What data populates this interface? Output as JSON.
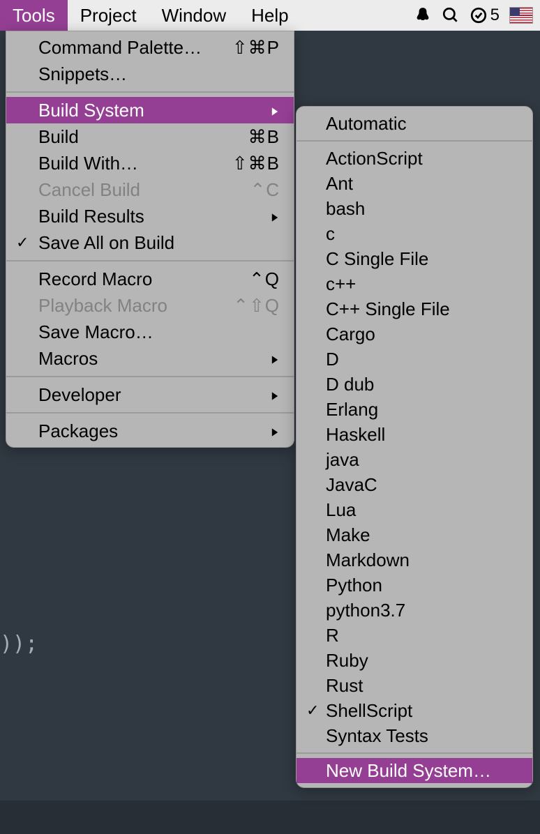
{
  "menubar": {
    "items": [
      {
        "label": "Tools",
        "active": true
      },
      {
        "label": "Project",
        "active": false
      },
      {
        "label": "Window",
        "active": false
      },
      {
        "label": "Help",
        "active": false
      }
    ],
    "badge_count": "5"
  },
  "editor": {
    "code_visible": "));"
  },
  "tools_menu": {
    "items": [
      {
        "label": "Command Palette…",
        "shortcut": "⇧⌘P",
        "type": "item"
      },
      {
        "label": "Snippets…",
        "shortcut": "",
        "type": "item"
      },
      {
        "type": "sep"
      },
      {
        "label": "Build System",
        "type": "submenu",
        "highlighted": true
      },
      {
        "label": "Build",
        "shortcut": "⌘B",
        "type": "item"
      },
      {
        "label": "Build With…",
        "shortcut": "⇧⌘B",
        "type": "item"
      },
      {
        "label": "Cancel Build",
        "shortcut": "⌃C",
        "type": "item",
        "disabled": true
      },
      {
        "label": "Build Results",
        "type": "submenu"
      },
      {
        "label": "Save All on Build",
        "type": "item",
        "checked": true
      },
      {
        "type": "sep"
      },
      {
        "label": "Record Macro",
        "shortcut": "⌃Q",
        "type": "item"
      },
      {
        "label": "Playback Macro",
        "shortcut": "⌃⇧Q",
        "type": "item",
        "disabled": true
      },
      {
        "label": "Save Macro…",
        "type": "item"
      },
      {
        "label": "Macros",
        "type": "submenu"
      },
      {
        "type": "sep"
      },
      {
        "label": "Developer",
        "type": "submenu"
      },
      {
        "type": "sep"
      },
      {
        "label": "Packages",
        "type": "submenu"
      }
    ]
  },
  "build_system_menu": {
    "items": [
      {
        "label": "Automatic"
      },
      {
        "type": "sep"
      },
      {
        "label": "ActionScript"
      },
      {
        "label": "Ant"
      },
      {
        "label": "bash"
      },
      {
        "label": "c"
      },
      {
        "label": "C Single File"
      },
      {
        "label": "c++"
      },
      {
        "label": "C++ Single File"
      },
      {
        "label": "Cargo"
      },
      {
        "label": "D"
      },
      {
        "label": "D dub"
      },
      {
        "label": "Erlang"
      },
      {
        "label": "Haskell"
      },
      {
        "label": "java"
      },
      {
        "label": "JavaC"
      },
      {
        "label": "Lua"
      },
      {
        "label": "Make"
      },
      {
        "label": "Markdown"
      },
      {
        "label": "Python"
      },
      {
        "label": "python3.7"
      },
      {
        "label": "R"
      },
      {
        "label": "Ruby"
      },
      {
        "label": "Rust"
      },
      {
        "label": "ShellScript",
        "checked": true
      },
      {
        "label": "Syntax Tests"
      },
      {
        "type": "sep"
      },
      {
        "label": "New Build System…",
        "highlighted": true
      }
    ]
  }
}
